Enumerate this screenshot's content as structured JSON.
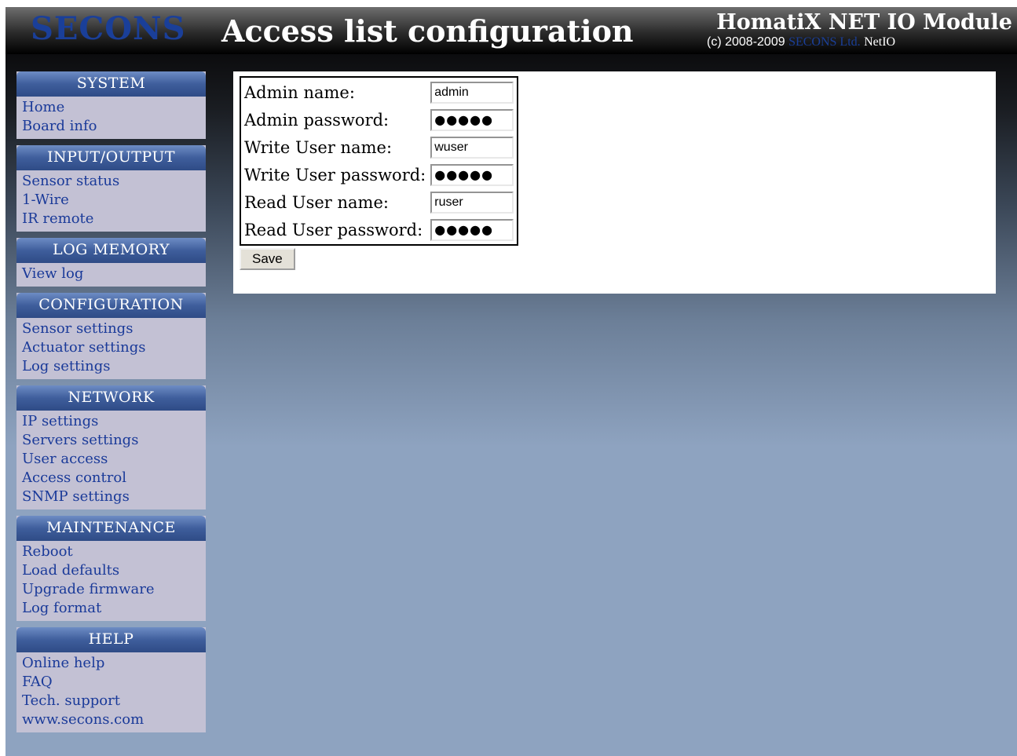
{
  "header": {
    "logo": "SECONS",
    "page_title": "Access list configuration",
    "module_title": "HomatiX NET IO Module",
    "copyright_prefix": "(c) 2008-2009",
    "copyright_company": "SECONS Ltd.",
    "copyright_product": "NetIO"
  },
  "sidebar": [
    {
      "title": "SYSTEM",
      "items": [
        "Home",
        "Board info"
      ]
    },
    {
      "title": "INPUT/OUTPUT",
      "items": [
        "Sensor status",
        "1-Wire",
        "IR remote"
      ]
    },
    {
      "title": "LOG MEMORY",
      "items": [
        "View log"
      ]
    },
    {
      "title": "CONFIGURATION",
      "items": [
        "Sensor settings",
        "Actuator settings",
        "Log settings"
      ]
    },
    {
      "title": "NETWORK",
      "items": [
        "IP settings",
        "Servers settings",
        "User access",
        "Access control",
        "SNMP settings"
      ]
    },
    {
      "title": "MAINTENANCE",
      "items": [
        "Reboot",
        "Load defaults",
        "Upgrade firmware",
        "Log format"
      ]
    },
    {
      "title": "HELP",
      "items": [
        "Online help",
        "FAQ",
        "Tech. support",
        "www.secons.com"
      ]
    }
  ],
  "form": {
    "fields": [
      {
        "label": "Admin name:",
        "value": "admin",
        "type": "text"
      },
      {
        "label": "Admin password:",
        "value": "●●●●●",
        "type": "password"
      },
      {
        "label": "Write User name:",
        "value": "wuser",
        "type": "text"
      },
      {
        "label": "Write User password:",
        "value": "●●●●●",
        "type": "password"
      },
      {
        "label": "Read User name:",
        "value": "ruser",
        "type": "text"
      },
      {
        "label": "Read User password:",
        "value": "●●●●●",
        "type": "password"
      }
    ],
    "save_label": "Save"
  }
}
